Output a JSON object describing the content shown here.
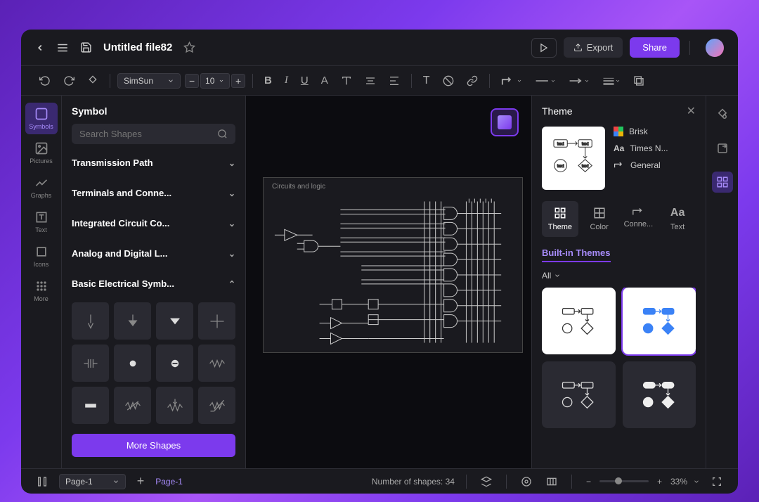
{
  "header": {
    "file_title": "Untitled file82",
    "export_label": "Export",
    "share_label": "Share"
  },
  "toolbar": {
    "font_name": "SimSun",
    "font_size": "10"
  },
  "rail": {
    "items": [
      {
        "label": "Symbols"
      },
      {
        "label": "Pictures"
      },
      {
        "label": "Graphs"
      },
      {
        "label": "Text"
      },
      {
        "label": "Icons"
      },
      {
        "label": "More"
      }
    ]
  },
  "symbol_panel": {
    "title": "Symbol",
    "search_placeholder": "Search Shapes",
    "categories": [
      {
        "name": "Transmission Path",
        "expanded": false
      },
      {
        "name": "Terminals and Conne...",
        "expanded": false
      },
      {
        "name": "Integrated Circuit Co...",
        "expanded": false
      },
      {
        "name": "Analog and Digital L...",
        "expanded": false
      },
      {
        "name": "Basic Electrical Symb...",
        "expanded": true
      }
    ],
    "more_shapes_label": "More Shapes"
  },
  "canvas": {
    "title": "Circuits and logic"
  },
  "theme_panel": {
    "title": "Theme",
    "current_name": "Brisk",
    "current_font": "Times N...",
    "current_connector": "General",
    "tabs": [
      {
        "label": "Theme"
      },
      {
        "label": "Color"
      },
      {
        "label": "Conne..."
      },
      {
        "label": "Text"
      }
    ],
    "section": "Built-in Themes",
    "filter": "All"
  },
  "footer": {
    "page_select": "Page-1",
    "page_tab": "Page-1",
    "shapes_count": "Number of shapes: 34",
    "zoom": "33%"
  }
}
